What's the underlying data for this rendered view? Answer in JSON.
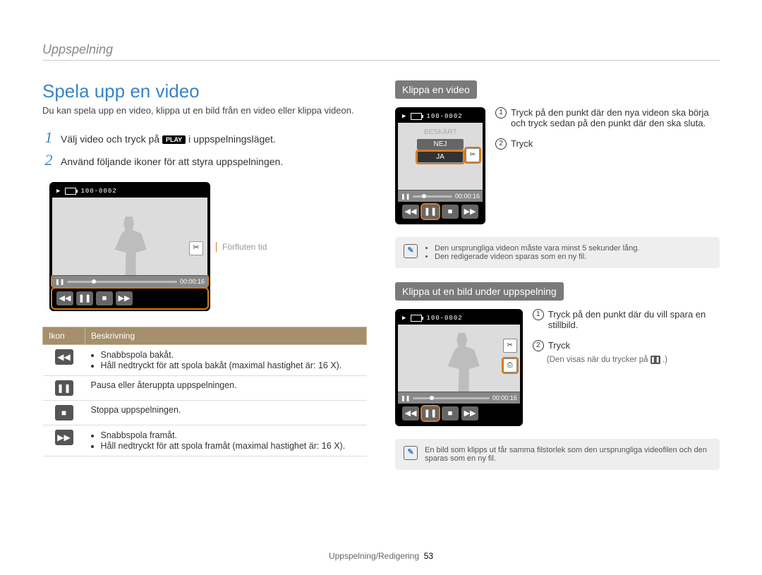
{
  "header": {
    "breadcrumb": "Uppspelning"
  },
  "title": "Spela upp en video",
  "lead": "Du kan spela upp en video, klippa ut en bild från en video eller klippa videon.",
  "steps": {
    "s1_num": "1",
    "s1_a": "Välj video och tryck på",
    "s1_play": "PLAY",
    "s1_b": " i uppspelningsläget.",
    "s2_num": "2",
    "s2": "Använd följande ikoner för att styra uppspelningen."
  },
  "player": {
    "file_no": "100-0002",
    "time": "00:00:16",
    "label_elapsed": "Förfluten tid"
  },
  "table": {
    "col_icon": "Ikon",
    "col_desc": "Beskrivning",
    "row1_a": "Snabbspola bakåt.",
    "row1_b": "Håll nedtryckt för att spola bakåt (maximal hastighet är: 16 X).",
    "row2": "Pausa eller återuppta uppspelningen.",
    "row3": "Stoppa uppspelningen.",
    "row4_a": "Snabbspola framåt.",
    "row4_b": "Håll nedtryckt för att spola framåt (maximal hastighet är: 16 X)."
  },
  "trim": {
    "heading": "Klippa en video",
    "dialog_q": "BESKÄR?",
    "dialog_no": "NEJ",
    "dialog_yes": "JA",
    "c1": "Tryck på den punkt där den nya videon ska börja och tryck sedan på den punkt där den ska sluta.",
    "c2": "Tryck",
    "note1": "Den ursprungliga videon måste vara minst 5 sekunder lång.",
    "note2": "Den redigerade videon sparas som en ny fil."
  },
  "capture": {
    "heading": "Klippa ut en bild under uppspelning",
    "c1": "Tryck på den punkt där du vill spara en stillbild.",
    "c2": "Tryck",
    "c2_note_a": "(Den visas när du trycker på ",
    "c2_note_b": ".)",
    "note": "En bild som klipps ut får samma filstorlek som den ursprungliga videofilen och den sparas som en ny fil."
  },
  "footer": {
    "section": "Uppspelning/Redigering",
    "page": "53"
  },
  "icons": {
    "rewind": "◀◀",
    "pause": "❚❚",
    "stop": "■",
    "forward": "▶▶",
    "play_small": "▶",
    "crop": "✂",
    "capture": "⎙"
  }
}
